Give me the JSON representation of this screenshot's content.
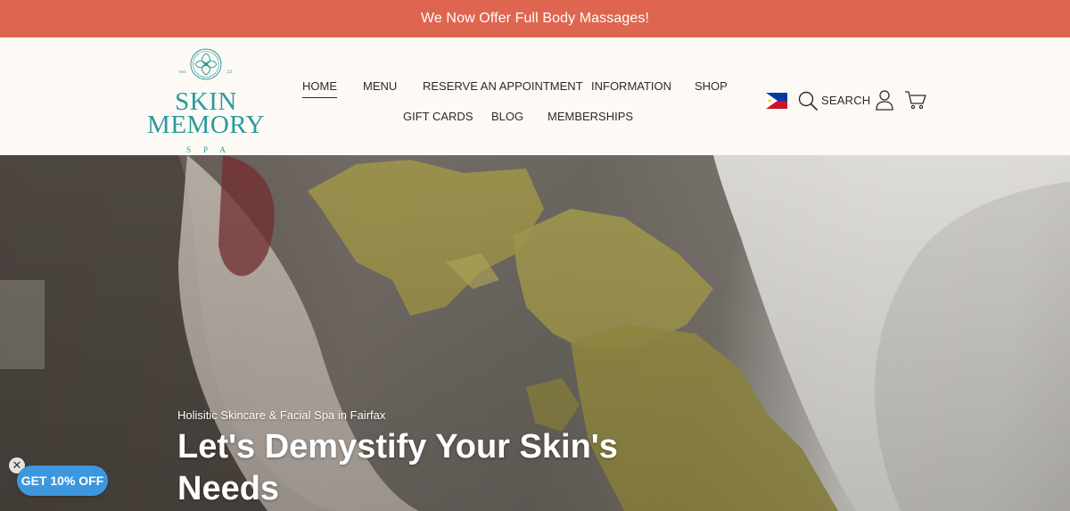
{
  "announcement": {
    "text": "We Now Offer Full Body Massages!"
  },
  "logo": {
    "line1": "SKIN",
    "line2": "MEMORY",
    "sub": "SPA",
    "est": "est",
    "year": "23"
  },
  "nav": {
    "home": "HOME",
    "menu": "MENU",
    "reserve": "RESERVE AN APPOINTMENT",
    "information": "INFORMATION",
    "shop": "SHOP",
    "gift_cards": "GIFT CARDS",
    "blog": "BLOG",
    "memberships": "MEMBERSHIPS"
  },
  "header_actions": {
    "search_label": "SEARCH",
    "flag_icon": "philippines-flag-icon",
    "search_icon": "search-icon",
    "account_icon": "user-icon",
    "cart_icon": "cart-icon"
  },
  "hero": {
    "subtitle": "Holisitic Skincare & Facial Spa in Fairfax",
    "title": "Let's Demystify Your Skin's Needs"
  },
  "discount": {
    "label": "GET 10% OFF",
    "close": "✕"
  },
  "colors": {
    "announcement_bg": "#de6650",
    "header_bg": "#fdfaf5",
    "brand_teal": "#2b9a9c",
    "discount_blue": "#3d97dd"
  }
}
